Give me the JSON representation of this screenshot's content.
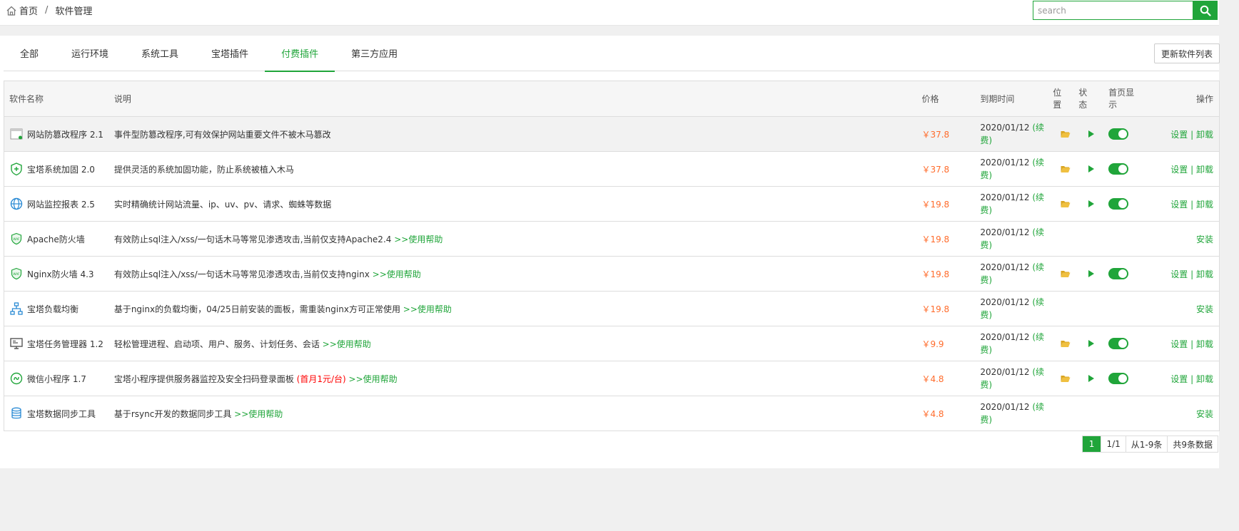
{
  "breadcrumb": {
    "home": "首页",
    "sep": "/",
    "current": "软件管理"
  },
  "search": {
    "placeholder": "search"
  },
  "tabs": [
    {
      "label": "全部"
    },
    {
      "label": "运行环境"
    },
    {
      "label": "系统工具"
    },
    {
      "label": "宝塔插件"
    },
    {
      "label": "付费插件",
      "active": true
    },
    {
      "label": "第三方应用"
    }
  ],
  "update_button": "更新软件列表",
  "table": {
    "headers": {
      "name": "软件名称",
      "desc": "说明",
      "price": "价格",
      "expire": "到期时间",
      "pos": "位置",
      "status": "状态",
      "home": "首页显示",
      "op": "操作"
    },
    "rows": [
      {
        "icon": "browser-lock-icon",
        "name": "网站防篡改程序 2.1",
        "desc": "事件型防篡改程序,可有效保护网站重要文件不被木马篡改",
        "help": "",
        "promo": "",
        "price": "￥37.8",
        "expire": "2020/01/12",
        "renew": "(续费)",
        "installed": true,
        "op1": "设置",
        "op_sep": "|",
        "op2": "卸载"
      },
      {
        "icon": "shield-plus-icon",
        "name": "宝塔系统加固 2.0",
        "desc": "提供灵活的系统加固功能，防止系统被植入木马",
        "help": "",
        "promo": "",
        "price": "￥37.8",
        "expire": "2020/01/12",
        "renew": "(续费)",
        "installed": true,
        "op1": "设置",
        "op_sep": "|",
        "op2": "卸载"
      },
      {
        "icon": "globe-icon",
        "name": "网站监控报表 2.5",
        "desc": "实时精确统计网站流量、ip、uv、pv、请求、蜘蛛等数据",
        "help": "",
        "promo": "",
        "price": "￥19.8",
        "expire": "2020/01/12",
        "renew": "(续费)",
        "installed": true,
        "op1": "设置",
        "op_sep": "|",
        "op2": "卸载"
      },
      {
        "icon": "waf-shield-icon",
        "name": "Apache防火墙",
        "desc": "有效防止sql注入/xss/一句话木马等常见渗透攻击,当前仅支持Apache2.4",
        "help": ">>使用帮助",
        "promo": "",
        "price": "￥19.8",
        "expire": "2020/01/12",
        "renew": "(续费)",
        "installed": false,
        "op1": "安装"
      },
      {
        "icon": "waf-shield-icon",
        "name": "Nginx防火墙 4.3",
        "desc": "有效防止sql注入/xss/一句话木马等常见渗透攻击,当前仅支持nginx",
        "help": ">>使用帮助",
        "promo": "",
        "price": "￥19.8",
        "expire": "2020/01/12",
        "renew": "(续费)",
        "installed": true,
        "op1": "设置",
        "op_sep": "|",
        "op2": "卸载"
      },
      {
        "icon": "network-tree-icon",
        "name": "宝塔负载均衡",
        "desc": "基于nginx的负载均衡，04/25日前安装的面板，需重装nginx方可正常使用",
        "help": ">>使用帮助",
        "promo": "",
        "price": "￥19.8",
        "expire": "2020/01/12",
        "renew": "(续费)",
        "installed": false,
        "op1": "安装"
      },
      {
        "icon": "monitor-icon",
        "name": "宝塔任务管理器 1.2",
        "desc": "轻松管理进程、启动项、用户、服务、计划任务、会话",
        "help": ">>使用帮助",
        "promo": "",
        "price": "￥9.9",
        "expire": "2020/01/12",
        "renew": "(续费)",
        "installed": true,
        "op1": "设置",
        "op_sep": "|",
        "op2": "卸载"
      },
      {
        "icon": "mini-program-icon",
        "name": "微信小程序 1.7",
        "desc": "宝塔小程序提供服务器监控及安全扫码登录面板",
        "help": ">>使用帮助",
        "promo": "(首月1元/台)",
        "price": "￥4.8",
        "expire": "2020/01/12",
        "renew": "(续费)",
        "installed": true,
        "op1": "设置",
        "op_sep": "|",
        "op2": "卸载"
      },
      {
        "icon": "database-sync-icon",
        "name": "宝塔数据同步工具",
        "desc": "基于rsync开发的数据同步工具",
        "help": ">>使用帮助",
        "promo": "",
        "price": "￥4.8",
        "expire": "2020/01/12",
        "renew": "(续费)",
        "installed": false,
        "op1": "安装"
      }
    ]
  },
  "pager": {
    "current": "1",
    "pages": "1/1",
    "range": "从1-9条",
    "total": "共9条数据"
  },
  "colors": {
    "accent": "#20a53a",
    "price": "#ff6c2c",
    "promo": "#ff0000",
    "folder": "#f0c040"
  }
}
